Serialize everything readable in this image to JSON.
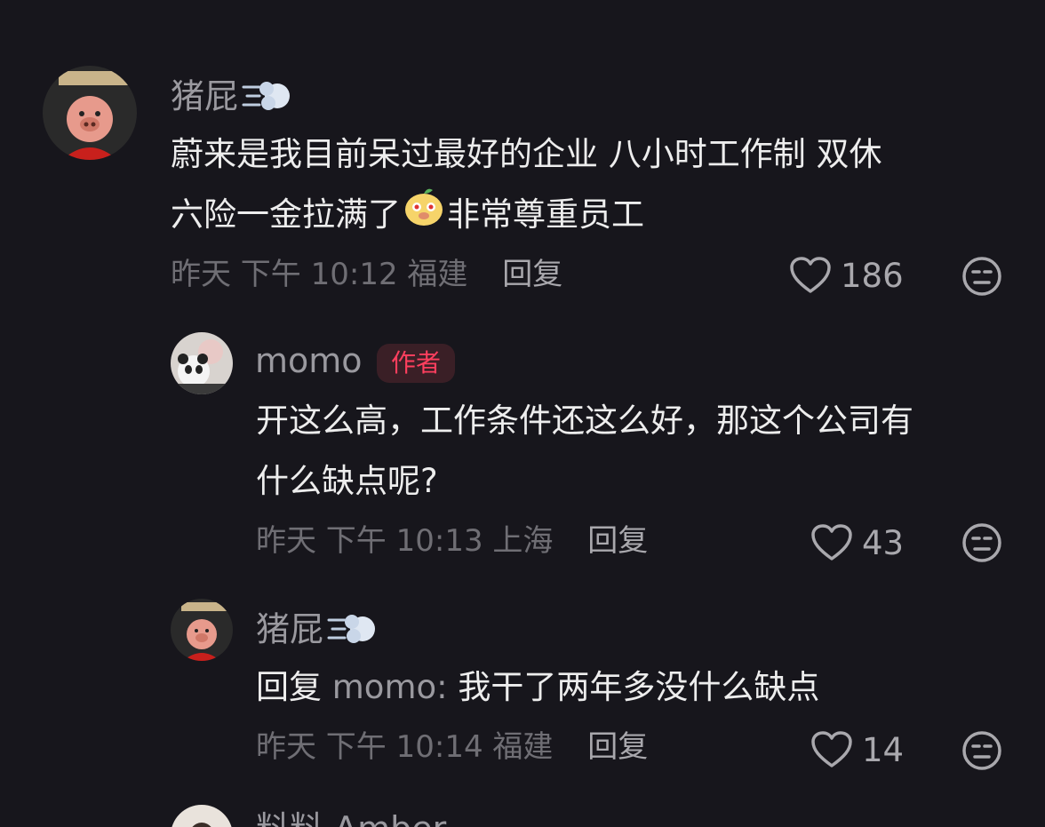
{
  "comments": [
    {
      "username": "猪屁",
      "username_emoji": "dash-icon",
      "text_lines": [
        "蔚来是我目前呆过最好的企业 八小时工作制 双休",
        "六险一金拉满了",
        "非常尊重员工"
      ],
      "inline_emoji": "pig-face-icon",
      "time": "昨天 下午 10:12",
      "location": "福建",
      "reply_label": "回复",
      "likes": "186"
    },
    {
      "username": "momo",
      "badge": "作者",
      "text_lines": [
        "开这么高，工作条件还这么好，那这个公司有",
        "什么缺点呢?"
      ],
      "time": "昨天 下午 10:13",
      "location": "上海",
      "reply_label": "回复",
      "likes": "43"
    },
    {
      "username": "猪屁",
      "username_emoji": "dash-icon",
      "reply_prefix": "回复",
      "reply_to": "momo:",
      "text": "我干了两年多没什么缺点",
      "time": "昨天 下午 10:14",
      "location": "福建",
      "reply_label": "回复",
      "likes": "14"
    },
    {
      "username": "料料 Amber"
    }
  ],
  "colors": {
    "background": "#17161c",
    "text": "#ededed",
    "muted": "#6f6e74",
    "author_badge": "#ff3f5e"
  }
}
